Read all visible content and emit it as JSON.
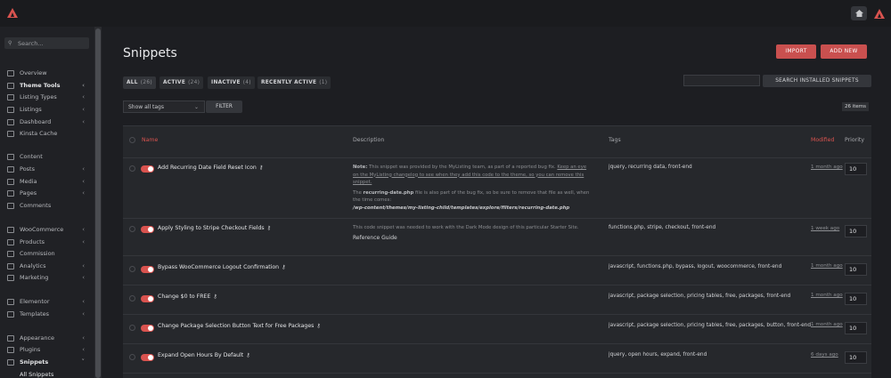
{
  "topbar": {
    "logo_icon": "logo-triangle-icon",
    "home_icon": "home-icon"
  },
  "sidebar": {
    "search_placeholder": "Search...",
    "items": [
      {
        "label": "Overview",
        "icon": "overview-icon",
        "chevron": false,
        "bold": false
      },
      {
        "label": "Theme Tools",
        "icon": "theme-tools-icon",
        "chevron": true,
        "bold": true
      },
      {
        "label": "Listing Types",
        "icon": "listing-types-icon",
        "chevron": true,
        "bold": false
      },
      {
        "label": "Listings",
        "icon": "listings-icon",
        "chevron": true,
        "bold": false
      },
      {
        "label": "Dashboard",
        "icon": "dashboard-icon",
        "chevron": true,
        "bold": false
      },
      {
        "label": "Kinsta Cache",
        "icon": "kinsta-icon",
        "chevron": false,
        "bold": false
      },
      {
        "label": "Content",
        "icon": "content-icon",
        "chevron": false,
        "bold": false
      },
      {
        "label": "Posts",
        "icon": "posts-icon",
        "chevron": true,
        "bold": false
      },
      {
        "label": "Media",
        "icon": "media-icon",
        "chevron": true,
        "bold": false
      },
      {
        "label": "Pages",
        "icon": "pages-icon",
        "chevron": true,
        "bold": false
      },
      {
        "label": "Comments",
        "icon": "comments-icon",
        "chevron": false,
        "bold": false
      },
      {
        "label": "WooCommerce",
        "icon": "woocommerce-icon",
        "chevron": true,
        "bold": false
      },
      {
        "label": "Products",
        "icon": "products-icon",
        "chevron": true,
        "bold": false
      },
      {
        "label": "Commission",
        "icon": "commission-icon",
        "chevron": false,
        "bold": false
      },
      {
        "label": "Analytics",
        "icon": "analytics-icon",
        "chevron": true,
        "bold": false
      },
      {
        "label": "Marketing",
        "icon": "marketing-icon",
        "chevron": true,
        "bold": false
      },
      {
        "label": "Elementor",
        "icon": "elementor-icon",
        "chevron": true,
        "bold": false
      },
      {
        "label": "Templates",
        "icon": "templates-icon",
        "chevron": true,
        "bold": false
      },
      {
        "label": "Appearance",
        "icon": "appearance-icon",
        "chevron": true,
        "bold": false
      },
      {
        "label": "Plugins",
        "icon": "plugins-icon",
        "chevron": true,
        "bold": false
      },
      {
        "label": "Snippets",
        "icon": "snippets-icon",
        "chevron": true,
        "bold": true
      },
      {
        "label": "All Snippets",
        "icon": "",
        "chevron": false,
        "bold": false
      }
    ]
  },
  "main": {
    "title": "Snippets",
    "import_label": "IMPORT",
    "add_new_label": "ADD NEW",
    "tabs": [
      {
        "label": "ALL",
        "count": "(26)"
      },
      {
        "label": "ACTIVE",
        "count": "(24)"
      },
      {
        "label": "INACTIVE",
        "count": "(4)"
      },
      {
        "label": "RECENTLY ACTIVE",
        "count": "(1)"
      }
    ],
    "search_value": "",
    "search_button": "SEARCH INSTALLED SNIPPETS",
    "tag_filter_value": "Show all tags",
    "filter_button": "FILTER",
    "items_count": "26 items",
    "accent_color": "#d9534f"
  },
  "table": {
    "headers": {
      "name": "Name",
      "description": "Description",
      "tags": "Tags",
      "modified": "Modified",
      "priority": "Priority"
    },
    "rows": [
      {
        "name": "Add Recurring Date Field Reset Icon",
        "desc_note": "Note:",
        "desc_1": "This snippet was provided by the MyListing team, as part of a reported bug fix.",
        "desc_link": "Keep an eye on the MyListing changelog to see when they add this code to the theme, so you can remove this snippet.",
        "desc_2a": "The ",
        "desc_2b": "recurring-date.php",
        "desc_2c": " file is also part of the bug fix, so be sure to remove that file as well, when the time comes:",
        "desc_path": "/wp-content/themes/my-listing-child/templates/explore/filters/recurring-date.php",
        "tags": "jquery, recurring data, front-end",
        "modified": "1 month ago",
        "priority": "10"
      },
      {
        "name": "Apply Styling to Stripe Checkout Fields",
        "desc_1": "This code snippet was needed to work with the Dark Mode design of this particular Starter Site.",
        "desc_2": "Reference Guide",
        "tags": "functions.php, stripe, checkout, front-end",
        "modified": "1 week ago",
        "priority": "10"
      },
      {
        "name": "Bypass WooCommerce Logout Confirmation",
        "tags": "javascript, functions.php, bypass, logout, woocommerce, front-end",
        "modified": "1 month ago",
        "priority": "10"
      },
      {
        "name": "Change $0 to FREE",
        "tags": "javascript, package selection, pricing tables, free, packages, front-end",
        "modified": "1 month ago",
        "priority": "10"
      },
      {
        "name": "Change Package Selection Button Text for Free Packages",
        "tags": "javascript, package selection, pricing tables, free, packages, button, front-end",
        "modified": "1 month ago",
        "priority": "10"
      },
      {
        "name": "Expand Open Hours By Default",
        "tags": "jquery, open hours, expand, front-end",
        "modified": "6 days ago",
        "priority": "10"
      }
    ]
  }
}
